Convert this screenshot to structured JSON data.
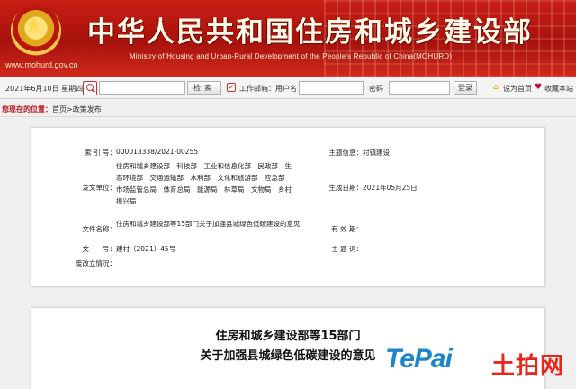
{
  "header": {
    "title_cn": "中华人民共和国住房和城乡建设部",
    "title_en": "Ministry of Housing and Urban-Rural Development of the People's Republic of China(MOHURD)",
    "site_url": "www.mohurd.gov.cn",
    "emblem_icon": "national-emblem-icon"
  },
  "toolbar": {
    "date": "2021年6月10日 星期四",
    "search_button": "检索",
    "work_account_label": "工作邮箱：用户名",
    "password_label": "密码",
    "login_button": "登录",
    "home_link": "设为首页",
    "favorite_link": "收藏本站"
  },
  "breadcrumb": {
    "lead": "您现在的位置：",
    "path": "首页>政策发布"
  },
  "meta": {
    "index_label": "索 引 号：",
    "index_value": "000013338/2021-00255",
    "topic_label": "主题信息：",
    "topic_value": "村镇建设",
    "issuers_label": "发文单位：",
    "issuers_value": "住房和城乡建设部　科技部　工业和信息化部　民政部　生态环境部　交通运输部　水利部　文化和旅游部　应急部　市场监管总局　体育总局　能源局　林草局　文物局　乡村振兴局",
    "date_label": "生成日期：",
    "date_value": "2021年05月25日",
    "docname_label": "文件名称：",
    "docname_value": "住房和城乡建设部等15部门关于加强县城绿色低碳建设的意见",
    "valid_label": "有 效 期：",
    "valid_value": "",
    "docno_label": "文　　号：",
    "docno_value": "建村〔2021〕45号",
    "keywords_label": "主 题 词：",
    "keywords_value": "",
    "abolish_label": "废改立情况：",
    "abolish_value": ""
  },
  "document": {
    "title_line1": "住房和城乡建设部等15部门",
    "title_line2": "关于加强县城绿色低碳建设的意见"
  },
  "watermark": {
    "brand_en": "TePai",
    "brand_cn": "土拍网"
  }
}
